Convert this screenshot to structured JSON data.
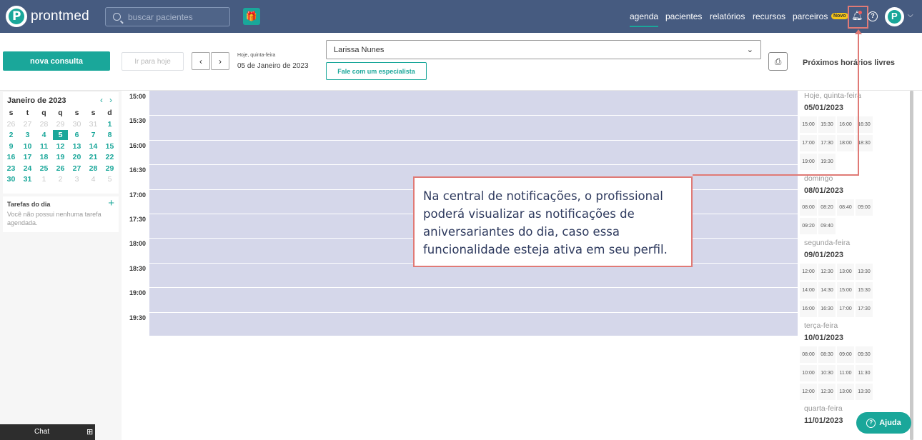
{
  "brand": {
    "name": "prontmed"
  },
  "search": {
    "placeholder": "buscar pacientes"
  },
  "nav": {
    "items": [
      "agenda",
      "pacientes",
      "relatórios",
      "recursos",
      "parceiros"
    ],
    "badge": "Novo"
  },
  "toolbar": {
    "new_consult": "nova consulta",
    "go_today": "Ir para hoje",
    "today_label": "Hoje, quinta-feira",
    "today_date": "05 de Janeiro de 2023",
    "professional": "Larissa Nunes",
    "specialist_button": "Fale com um especialista",
    "next_slots_title": "Próximos horários livres"
  },
  "calendar": {
    "month": "Janeiro de 2023",
    "weekdays": [
      "s",
      "t",
      "q",
      "q",
      "s",
      "s",
      "d"
    ],
    "weeks": [
      [
        "26",
        "27",
        "28",
        "29",
        "30",
        "31",
        "1"
      ],
      [
        "2",
        "3",
        "4",
        "5",
        "6",
        "7",
        "8"
      ],
      [
        "9",
        "10",
        "11",
        "12",
        "13",
        "14",
        "15"
      ],
      [
        "16",
        "17",
        "18",
        "19",
        "20",
        "21",
        "22"
      ],
      [
        "23",
        "24",
        "25",
        "26",
        "27",
        "28",
        "29"
      ],
      [
        "30",
        "31",
        "1",
        "2",
        "3",
        "4",
        "5"
      ]
    ],
    "selected": "5"
  },
  "tasks": {
    "title": "Tarefas do dia",
    "empty": "Você não possui nenhuma tarefa agendada."
  },
  "schedule": {
    "times": [
      "15:00",
      "15:30",
      "16:00",
      "16:30",
      "17:00",
      "17:30",
      "18:00",
      "18:30",
      "19:00",
      "19:30"
    ]
  },
  "free_slots": [
    {
      "label": "Hoje, quinta-feira",
      "date": "05/01/2023",
      "times": [
        "15:00",
        "15:30",
        "16:00",
        "16:30",
        "17:00",
        "17:30",
        "18:00",
        "18:30",
        "19:00",
        "19:30"
      ]
    },
    {
      "label": "domingo",
      "date": "08/01/2023",
      "times": [
        "08:00",
        "08:20",
        "08:40",
        "09:00",
        "09:20",
        "09:40"
      ]
    },
    {
      "label": "segunda-feira",
      "date": "09/01/2023",
      "times": [
        "12:00",
        "12:30",
        "13:00",
        "13:30",
        "14:00",
        "14:30",
        "15:00",
        "15:30",
        "16:00",
        "16:30",
        "17:00",
        "17:30"
      ]
    },
    {
      "label": "terça-feira",
      "date": "10/01/2023",
      "times": [
        "08:00",
        "08:30",
        "09:00",
        "09:30",
        "10:00",
        "10:30",
        "11:00",
        "11:30",
        "12:00",
        "12:30",
        "13:00",
        "13:30"
      ]
    },
    {
      "label": "quarta-feira",
      "date": "11/01/2023",
      "times": []
    }
  ],
  "annotation": {
    "text": "Na central de notificações, o profissional poderá visualizar as notificações de aniversariantes do dia, caso essa funcionalidade esteja ativa em seu perfil."
  },
  "chat": {
    "label": "Chat"
  },
  "help": {
    "label": "Ajuda"
  },
  "colors": {
    "topbar": "#465b80",
    "accent": "#1aa79a",
    "schedule_fill": "#d5d7ea",
    "callout_border": "#e07a76"
  }
}
